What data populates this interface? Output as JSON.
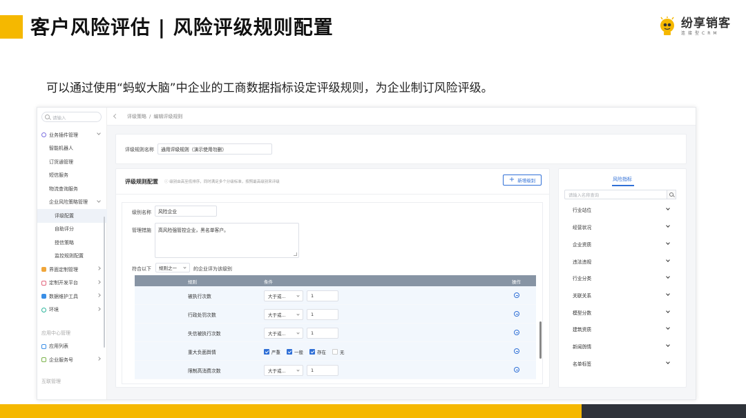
{
  "slide": {
    "title": "客户风险评估 | 风险评级规则配置",
    "subtitle": "可以通过使用“蚂蚁大脑”中企业的工商数据指标设定评级规则，为企业制订风险评级。",
    "logo_name": "纷享销客",
    "logo_sub": "连接型CRM",
    "accent_color": "#f5b800",
    "dark_color": "#2f333a"
  },
  "sidebar": {
    "search_placeholder": "请输入",
    "items": [
      {
        "label": "业务插件管理",
        "icon": "plugin-icon",
        "arrow": "down"
      },
      {
        "label": "智能机器人"
      },
      {
        "label": "订货通管理"
      },
      {
        "label": "短信服务"
      },
      {
        "label": "物流查询服务"
      },
      {
        "label": "企业风险策略管理",
        "arrow": "down"
      },
      {
        "label": "评级配置",
        "active": true
      },
      {
        "label": "自助评分"
      },
      {
        "label": "授信策略"
      },
      {
        "label": "监控规则配置"
      },
      {
        "label": "界面定制管理",
        "icon": "layout-icon",
        "arrow": "right"
      },
      {
        "label": "定制开发平台",
        "icon": "dev-icon",
        "arrow": "right"
      },
      {
        "label": "数据维护工具",
        "icon": "data-icon",
        "arrow": "right"
      },
      {
        "label": "环境",
        "icon": "env-icon",
        "arrow": "right"
      },
      {
        "label": "应用中心管理",
        "muted": true
      },
      {
        "label": "应用列表",
        "icon": "app-icon"
      },
      {
        "label": "企业服务号",
        "icon": "service-icon",
        "arrow": "right"
      },
      {
        "label": "互联管理",
        "muted": true
      }
    ]
  },
  "breadcrumb": {
    "items": [
      "评级策略",
      "/",
      "编辑评级规则"
    ]
  },
  "rule_form": {
    "name_label": "评级规则名称",
    "name_value": "通用评级规则（演示使用勿删）"
  },
  "config": {
    "title": "评级规则配置",
    "hint": "级别由高至低排序，同时满足多个分级标准，按照最高级别来评级",
    "add_button": "新增级别",
    "level_label": "级别名称",
    "level_value": "风险企业",
    "measure_label": "管理措施",
    "measure_value": "高风险强管控企业，黑名单客户。",
    "match_prefix": "符合以下",
    "match_select": "规则之一",
    "match_suffix": "的企业评为该级别",
    "columns": {
      "rule": "规则",
      "condition": "条件",
      "action": "操作"
    },
    "rows": [
      {
        "rule": "被执行次数",
        "op": "大于或...",
        "value": "1"
      },
      {
        "rule": "行政处罚次数",
        "op": "大于或...",
        "value": "1"
      },
      {
        "rule": "失信被执行次数",
        "op": "大于或...",
        "value": "1"
      },
      {
        "rule": "重大负面舆情",
        "checks": [
          {
            "label": "严重",
            "checked": true
          },
          {
            "label": "一般",
            "checked": true
          },
          {
            "label": "存在",
            "checked": true
          },
          {
            "label": "无",
            "checked": false
          }
        ]
      },
      {
        "rule": "限制高消费次数",
        "op": "大于或...",
        "value": "1"
      }
    ]
  },
  "indicators": {
    "tab": "风险指标",
    "search_placeholder": "请输入名称查询",
    "items": [
      "行业站位",
      "经营状况",
      "企业资质",
      "违法违规",
      "行业分类",
      "关联关系",
      "模型分数",
      "建筑资质",
      "新闻舆情",
      "名单标签"
    ]
  },
  "colors": {
    "primary": "#2f6fd6",
    "table_header": "#8794a4",
    "row_bg": "#f2f7fd"
  }
}
